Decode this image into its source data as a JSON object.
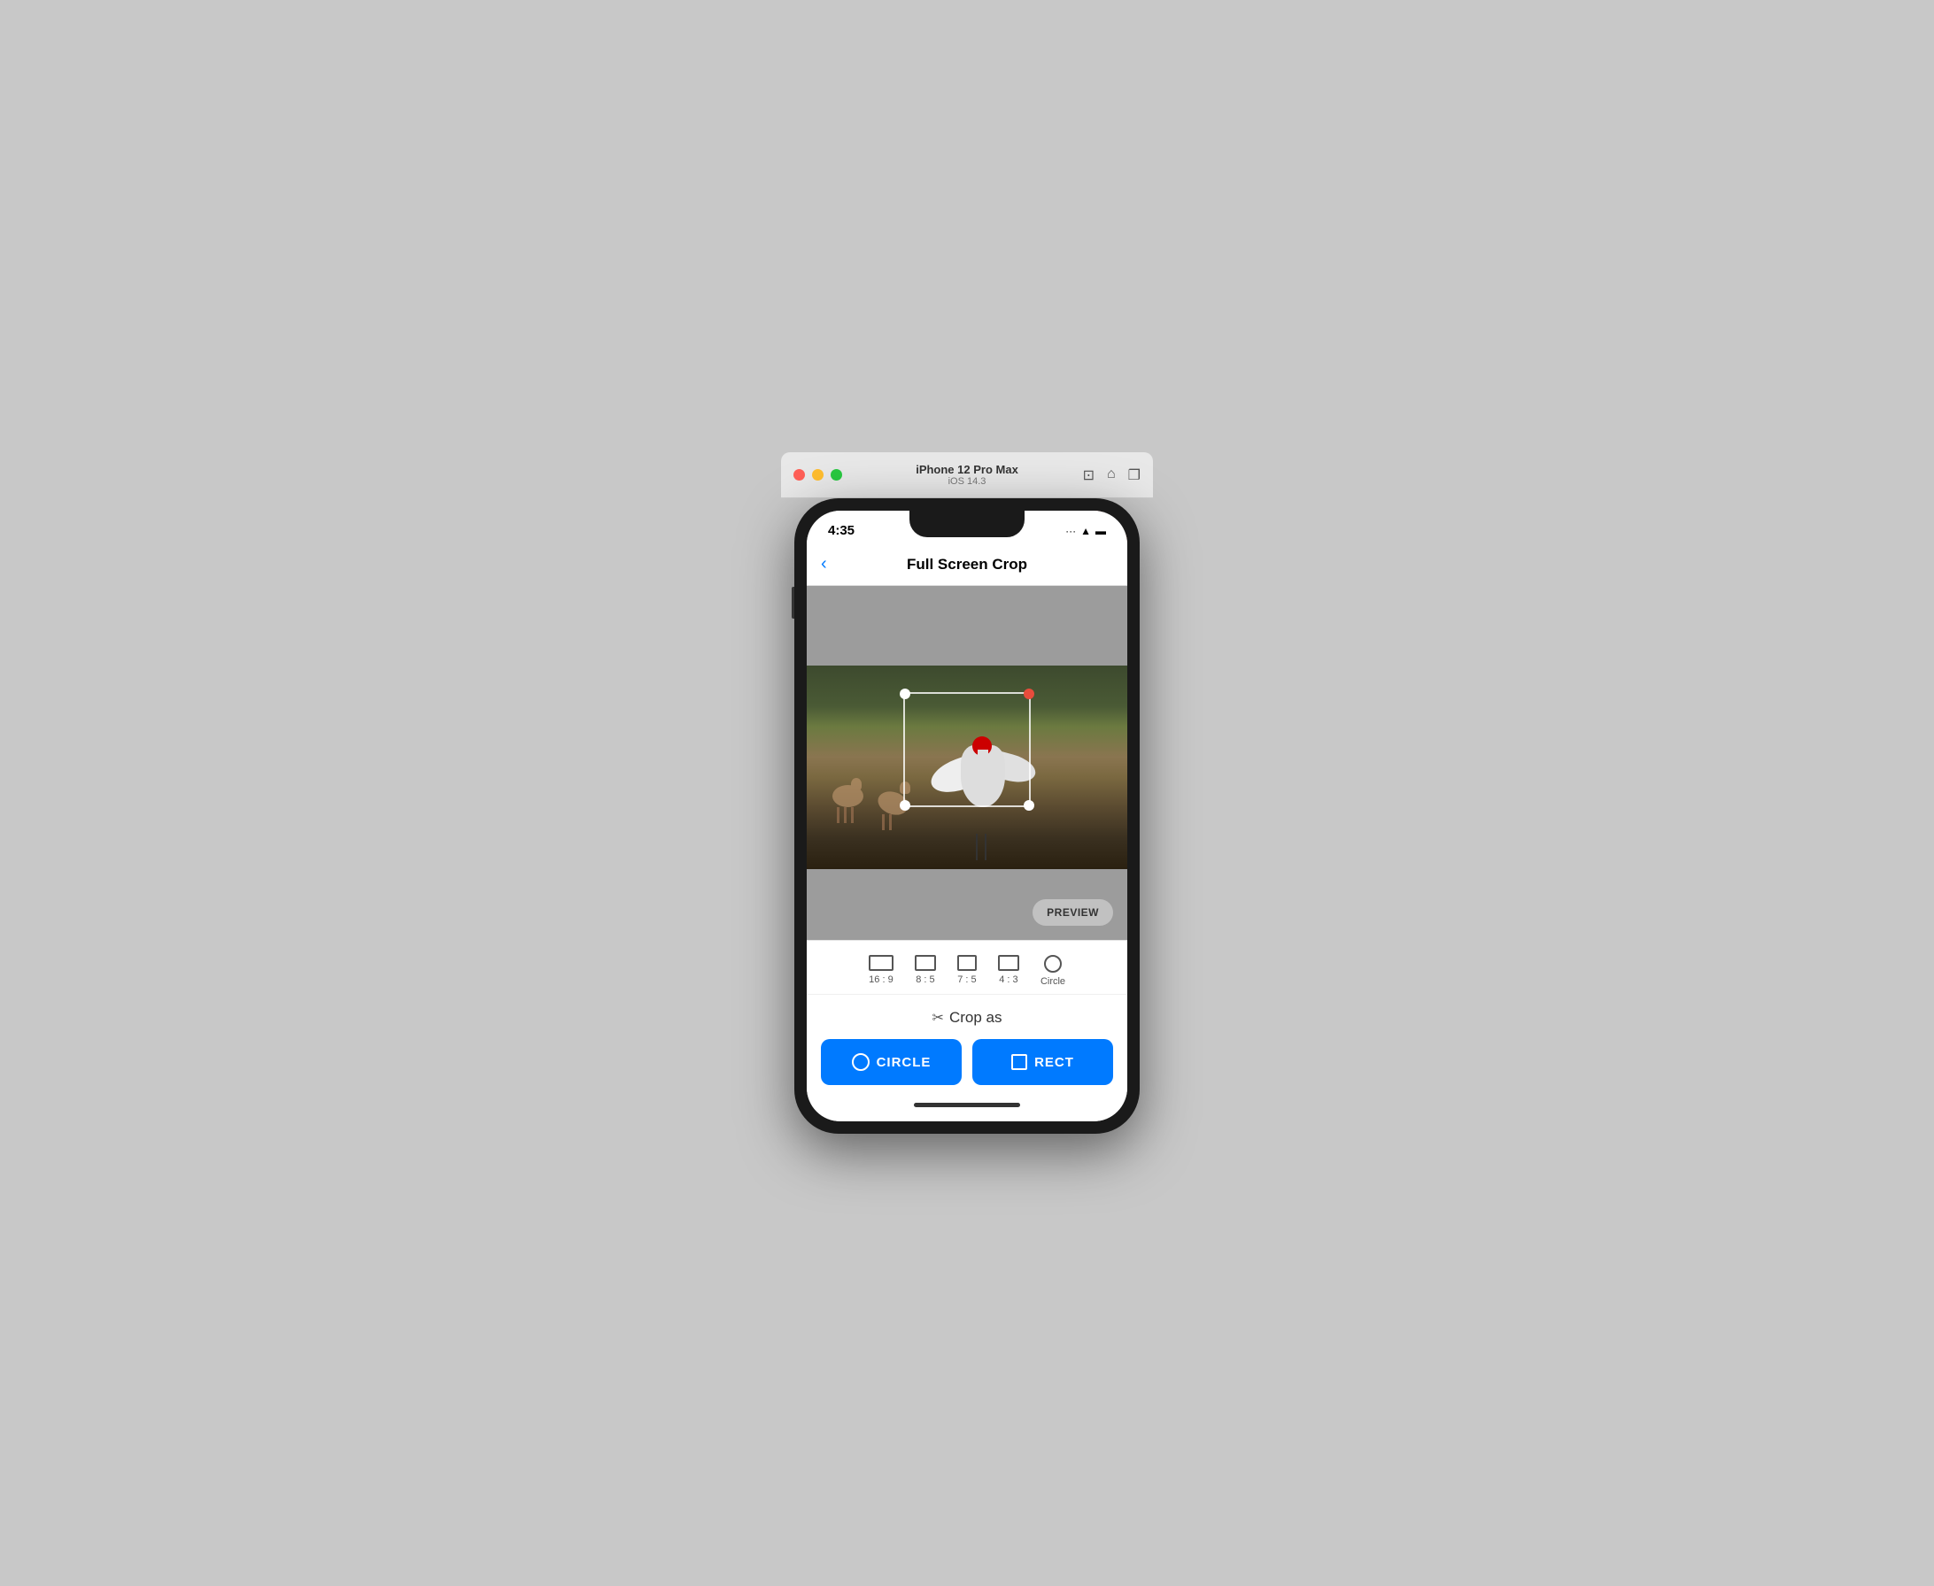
{
  "titlebar": {
    "device": "iPhone 12 Pro Max",
    "version": "iOS 14.3",
    "traffic_lights": {
      "red": "close",
      "yellow": "minimize",
      "green": "maximize"
    },
    "icons": [
      "screenshot-icon",
      "home-icon",
      "layers-icon"
    ]
  },
  "status_bar": {
    "time": "4:35",
    "signal": "···",
    "wifi": "wifi",
    "battery": "battery"
  },
  "nav": {
    "back_label": "‹",
    "title": "Full Screen Crop"
  },
  "preview_button": {
    "label": "PREVIEW"
  },
  "ratio_options": [
    {
      "id": "16:9",
      "label": "16 : 9",
      "icon_type": "rect-wide"
    },
    {
      "id": "8:5",
      "label": "8 : 5",
      "icon_type": "rect-85"
    },
    {
      "id": "7:5",
      "label": "7 : 5",
      "icon_type": "rect-75"
    },
    {
      "id": "4:3",
      "label": "4 : 3",
      "icon_type": "rect-43"
    },
    {
      "id": "circle",
      "label": "Circle",
      "icon_type": "circle"
    }
  ],
  "crop_as": {
    "title": "Crop as",
    "scissors": "✂",
    "circle_btn": "CIRCLE",
    "rect_btn": "RECT"
  }
}
